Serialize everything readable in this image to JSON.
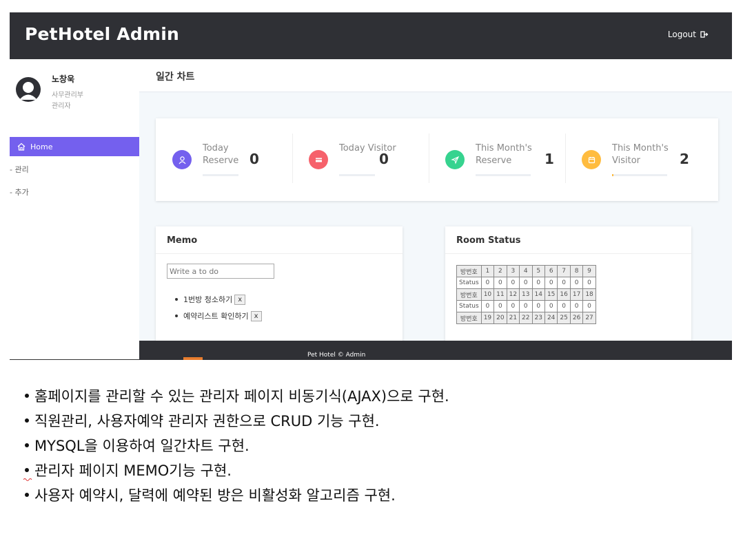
{
  "app": {
    "brand": "PetHotel Admin",
    "logout_label": "Logout"
  },
  "user": {
    "name": "노창욱",
    "department": "사무관리부",
    "role": "관리자"
  },
  "sidebar": {
    "items": [
      {
        "label": "Home",
        "active": true
      },
      {
        "label": "- 관리"
      },
      {
        "label": "- 추가"
      }
    ]
  },
  "page": {
    "title": "일간 차트"
  },
  "stats": [
    {
      "label": "Today Reserve",
      "value": "0",
      "color": "#7460ee",
      "icon": "user-icon",
      "progress": 0
    },
    {
      "label": "Today Visitor",
      "value": "0",
      "color": "#f6616b",
      "icon": "card-icon",
      "progress": 0
    },
    {
      "label": "This Month's Reserve",
      "value": "1",
      "color": "#36d38f",
      "icon": "send-icon",
      "progress": 0
    },
    {
      "label": "This Month's Visitor",
      "value": "2",
      "color": "#ffbc3f",
      "icon": "calendar-icon",
      "progress": 0.03
    }
  ],
  "memo": {
    "title": "Memo",
    "placeholder": "Write a to do",
    "todos": [
      "1번방 청소하기",
      "예약리스트 확인하기"
    ],
    "delete_label": "x"
  },
  "rooms": {
    "title": "Room Status",
    "room_label": "방번호",
    "status_label": "Status",
    "rows": [
      {
        "rooms": [
          "1",
          "2",
          "3",
          "4",
          "5",
          "6",
          "7",
          "8",
          "9"
        ],
        "status": [
          "0",
          "0",
          "0",
          "0",
          "0",
          "0",
          "0",
          "0",
          "0"
        ]
      },
      {
        "rooms": [
          "10",
          "11",
          "12",
          "13",
          "14",
          "15",
          "16",
          "17",
          "18"
        ],
        "status": [
          "0",
          "0",
          "0",
          "0",
          "0",
          "0",
          "0",
          "0",
          "0"
        ]
      },
      {
        "rooms": [
          "19",
          "20",
          "21",
          "22",
          "23",
          "24",
          "25",
          "26",
          "27"
        ]
      }
    ]
  },
  "footer": {
    "text": "Pet Hotel © Admin"
  },
  "bullets": [
    "홈페이지를 관리할 수 있는 관리자 페이지 비동기식(AJAX)으로 구현.",
    "직원관리, 사용자예약 관리자 권한으로 CRUD 기능 구현.",
    "MYSQL을 이용하여 일간차트 구현.",
    "관리자 페이지 MEMO기능 구현.",
    "사용자 예약시, 달력에 예약된 방은 비활성화 알고리즘 구현."
  ]
}
